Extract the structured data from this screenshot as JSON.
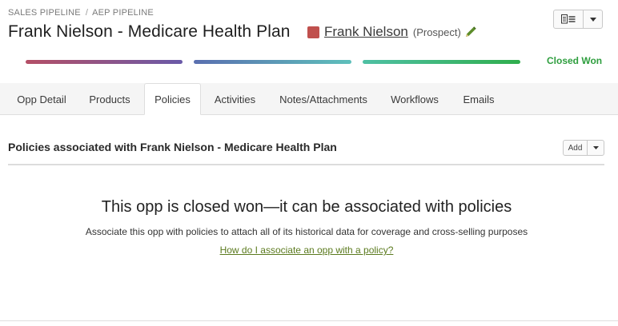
{
  "breadcrumb": [
    "SALES PIPELINE",
    "AEP PIPELINE"
  ],
  "breadcrumb_separator": "/",
  "title": "Frank Nielson - Medicare Health Plan",
  "contact": {
    "name": "Frank Nielson",
    "role": "(Prospect)",
    "swatch_color": "#c0504d"
  },
  "pipeline": {
    "stages": [
      {
        "gradient": [
          "#b44f66",
          "#6a5aa8"
        ]
      },
      {
        "gradient": [
          "#5a6fb0",
          "#5ec0bb"
        ]
      },
      {
        "gradient": [
          "#4fc0a4",
          "#2fae4d"
        ]
      }
    ],
    "status": "Closed Won",
    "status_color": "#2e9e3e"
  },
  "tabs": [
    {
      "label": "Opp Detail"
    },
    {
      "label": "Products"
    },
    {
      "label": "Policies",
      "active": true
    },
    {
      "label": "Activities"
    },
    {
      "label": "Notes/Attachments"
    },
    {
      "label": "Workflows"
    },
    {
      "label": "Emails"
    }
  ],
  "policies": {
    "section_title": "Policies associated with Frank Nielson - Medicare Health Plan",
    "add_label": "Add",
    "empty_heading": "This opp is closed won—it can be associated with policies",
    "empty_description": "Associate this opp with policies to attach all of its historical data for coverage and cross-selling purposes",
    "help_link": "How do I associate an opp with a policy?",
    "help_link_color": "#5b7a1e"
  },
  "icons": {
    "edit": "pencil-icon",
    "document": "document-list-icon",
    "dropdown": "caret-down-icon"
  },
  "colors": {
    "pencil": "#5c8c2a"
  }
}
